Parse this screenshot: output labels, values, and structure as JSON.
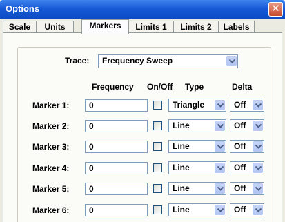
{
  "window": {
    "title": "Options",
    "close_icon": "close-icon"
  },
  "tabs": [
    "Scale",
    "Units",
    "Markers",
    "Limits 1",
    "Limits 2",
    "Labels"
  ],
  "active_tab": "Markers",
  "trace": {
    "label": "Trace:",
    "value": "Frequency Sweep"
  },
  "columns": {
    "frequency": "Frequency",
    "onoff": "On/Off",
    "type": "Type",
    "delta": "Delta"
  },
  "markers": [
    {
      "label": "Marker 1:",
      "frequency": "0",
      "type": "Triangle",
      "delta": "Off"
    },
    {
      "label": "Marker 2:",
      "frequency": "0",
      "type": "Line",
      "delta": "Off"
    },
    {
      "label": "Marker 3:",
      "frequency": "0",
      "type": "Line",
      "delta": "Off"
    },
    {
      "label": "Marker 4:",
      "frequency": "0",
      "type": "Line",
      "delta": "Off"
    },
    {
      "label": "Marker 5:",
      "frequency": "0",
      "type": "Line",
      "delta": "Off"
    },
    {
      "label": "Marker 6:",
      "frequency": "0",
      "type": "Line",
      "delta": "Off"
    }
  ],
  "colors": {
    "title_bar": "#1659d6",
    "close_button": "#c84a2c",
    "input_border": "#7f9db9"
  }
}
